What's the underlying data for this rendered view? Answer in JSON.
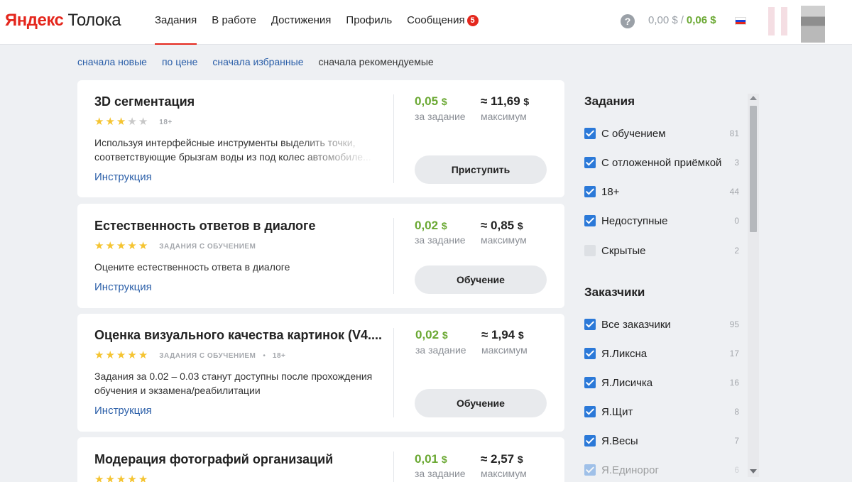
{
  "header": {
    "logo_brand": "Яндекс",
    "logo_product": "Толока",
    "nav": [
      {
        "label": "Задания"
      },
      {
        "label": "В работе"
      },
      {
        "label": "Достижения"
      },
      {
        "label": "Профиль"
      },
      {
        "label": "Сообщения",
        "badge": "5"
      }
    ],
    "help_icon": "?",
    "balance_pending": "0,00 $",
    "balance_separator": "/",
    "balance_available": "0,06 $",
    "language_flag": "ru-flag-icon"
  },
  "sort": {
    "options": [
      "сначала новые",
      "по цене",
      "сначала избранные",
      "сначала рекомендуемые"
    ],
    "active": "сначала рекомендуемые"
  },
  "tasks": [
    {
      "title": "3D сегментация",
      "rating": 3,
      "rating_max": 5,
      "tags": [
        "18+"
      ],
      "desc": "Используя интерфейсные инструменты выделить точки, соответствующие брызгам воды из под колес автомобиле...",
      "instruction": "Инструкция",
      "price": "0,05",
      "price_unit": "$",
      "price_caption": "за задание",
      "max": "≈ 11,69",
      "max_unit": "$",
      "max_caption": "максимум",
      "button": "Приступить"
    },
    {
      "title": "Естественность ответов в диалоге",
      "rating": 5,
      "rating_max": 5,
      "tags": [
        "ЗАДАНИЯ С ОБУЧЕНИЕМ"
      ],
      "desc": "Оцените естественность ответа в диалоге",
      "instruction": "Инструкция",
      "price": "0,02",
      "price_unit": "$",
      "price_caption": "за задание",
      "max": "≈ 0,85",
      "max_unit": "$",
      "max_caption": "максимум",
      "button": "Обучение"
    },
    {
      "title": "Оценка визуального качества картинок (V4....",
      "rating": 5,
      "rating_max": 5,
      "tags": [
        "ЗАДАНИЯ С ОБУЧЕНИЕМ",
        "18+"
      ],
      "desc": "Задания за 0.02 – 0.03 станут доступны после прохождения обучения и экзамена/реабилитации",
      "instruction": "Инструкция",
      "price": "0,02",
      "price_unit": "$",
      "price_caption": "за задание",
      "max": "≈ 1,94",
      "max_unit": "$",
      "max_caption": "максимум",
      "button": "Обучение"
    },
    {
      "title": "Модерация фотографий организаций",
      "price": "0,01",
      "price_unit": "$",
      "price_caption": "за задание",
      "max": "≈ 2,57",
      "max_unit": "$",
      "max_caption": "максимум"
    }
  ],
  "filters": {
    "tasks_heading": "Задания",
    "tasks": [
      {
        "label": "С обучением",
        "count": "81",
        "checked": true
      },
      {
        "label": "С отложенной приёмкой",
        "count": "3",
        "checked": true
      },
      {
        "label": "18+",
        "count": "44",
        "checked": true
      },
      {
        "label": "Недоступные",
        "count": "0",
        "checked": true
      },
      {
        "label": "Скрытые",
        "count": "2",
        "checked": false
      }
    ],
    "requesters_heading": "Заказчики",
    "requesters": [
      {
        "label": "Все заказчики",
        "count": "95",
        "checked": true
      },
      {
        "label": "Я.Ликсна",
        "count": "17",
        "checked": true
      },
      {
        "label": "Я.Лисичка",
        "count": "16",
        "checked": true
      },
      {
        "label": "Я.Щит",
        "count": "8",
        "checked": true
      },
      {
        "label": "Я.Весы",
        "count": "7",
        "checked": true
      },
      {
        "label": "Я.Единорог",
        "count": "6",
        "checked": true
      }
    ]
  },
  "colors": {
    "accent": "#e4271d",
    "price_green": "#6aa832",
    "link_blue": "#2a5ea8",
    "checkbox_blue": "#2b79d8"
  }
}
